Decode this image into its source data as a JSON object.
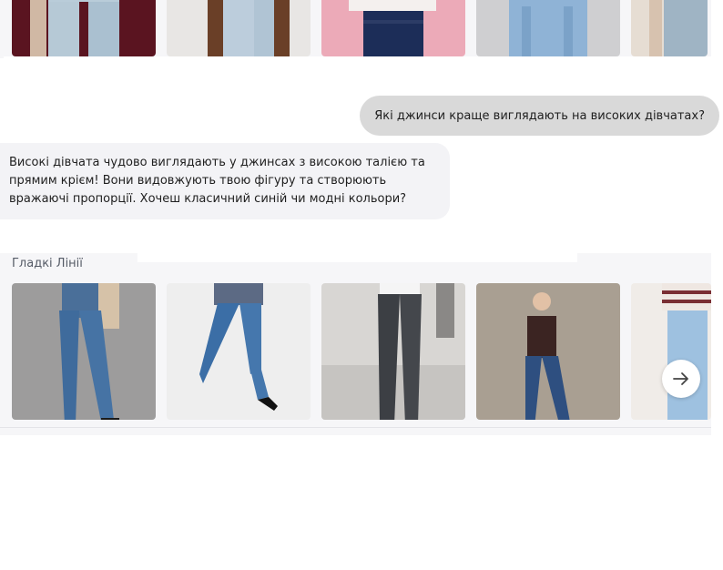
{
  "chat": {
    "user_message": "Які джинси краще виглядають на високих дівчатах?",
    "bot_message": "Високі дівчата чудово виглядають у джинсах з високою талією та прямим крієм! Вони видовжують твою фігуру та створюють вражаючі пропорції. Хочеш класичний синій чи модні кольори?"
  },
  "recommendations": {
    "section_title": "Гладкі Лінії"
  },
  "icons": {
    "next": "arrow-right-icon"
  }
}
